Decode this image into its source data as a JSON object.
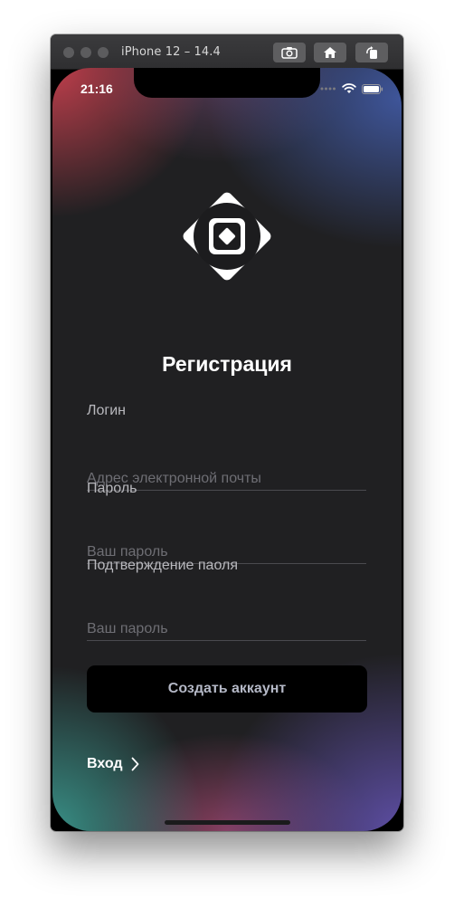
{
  "simulator": {
    "title": "iPhone 12 – 14.4",
    "toolbar": [
      "screenshot-icon",
      "home-icon",
      "rotate-icon"
    ]
  },
  "status_bar": {
    "time": "21:16",
    "icons": [
      "signal-icon",
      "wifi-icon",
      "battery-icon"
    ]
  },
  "screen": {
    "logo": "app-logo-icon",
    "title": "Регистрация",
    "fields": [
      {
        "label": "Логин",
        "placeholder": "Адрес электронной почты",
        "value": ""
      },
      {
        "label": "Пароль",
        "placeholder": "Ваш пароль",
        "value": ""
      },
      {
        "label": "Подтверждение паоля",
        "placeholder": "Ваш пароль",
        "value": ""
      }
    ],
    "create_button": "Создать аккаунт",
    "login_link": "Вход"
  },
  "colors": {
    "background": "#202022",
    "accent_red": "#c8404e",
    "accent_blue": "#4058a0",
    "accent_teal": "#3a968c",
    "accent_purple": "#6050aa",
    "button_bg": "#000000",
    "button_text": "#b4b8c6"
  }
}
